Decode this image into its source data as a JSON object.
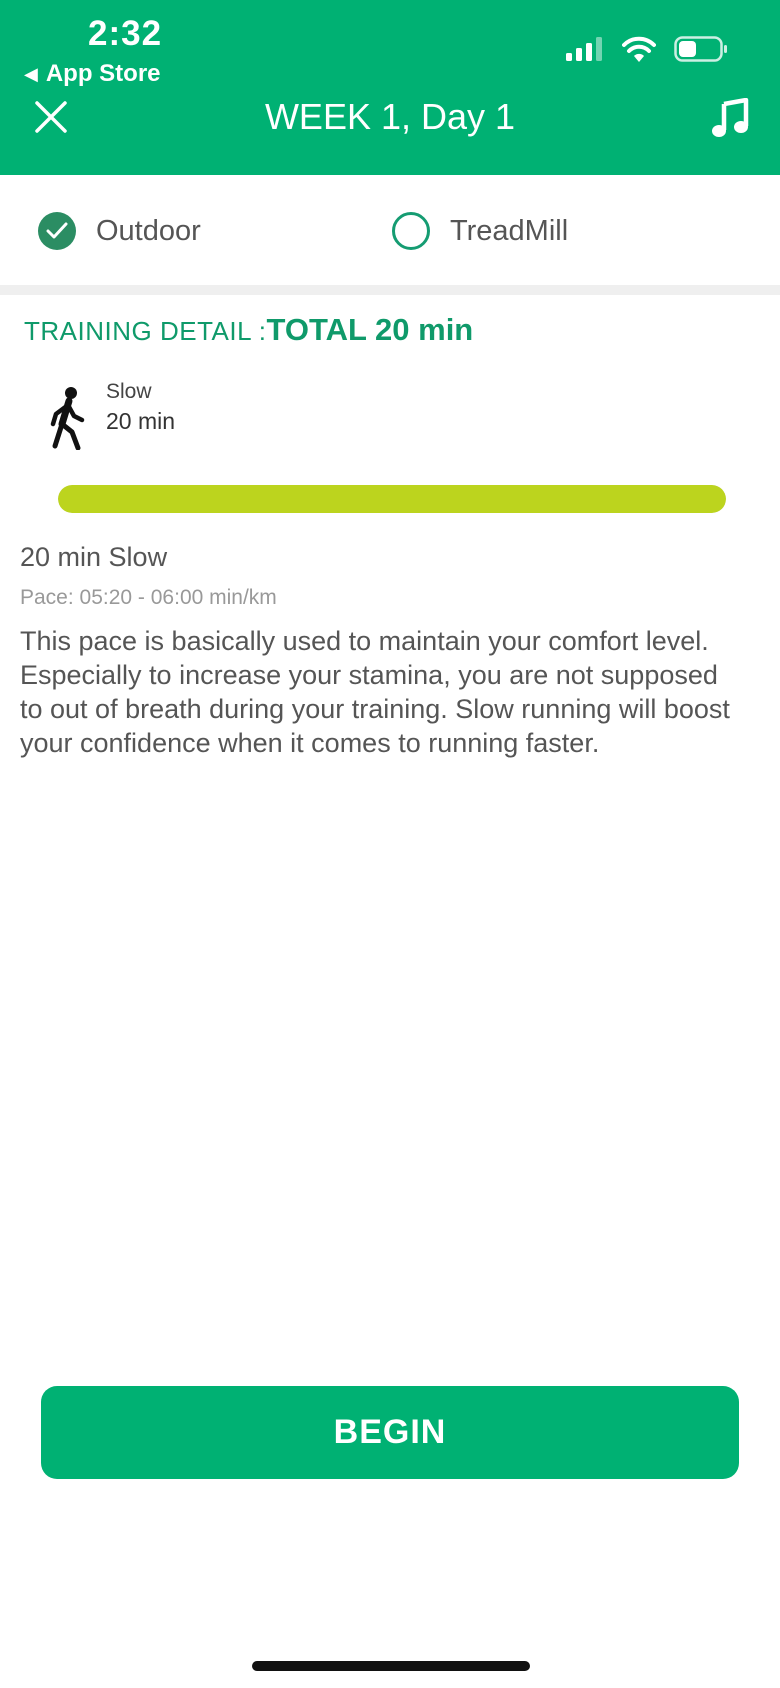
{
  "status_bar": {
    "time": "2:32",
    "back_label": "App Store",
    "back_arrow_icon": "triangle-left-icon",
    "icons": [
      "cellular-signal-icon",
      "wifi-icon",
      "battery-icon"
    ]
  },
  "nav": {
    "close_icon": "close-icon",
    "title": "WEEK 1, Day 1",
    "music_icon": "music-note-icon"
  },
  "modes": {
    "outdoor": {
      "label": "Outdoor",
      "selected": true
    },
    "treadmill": {
      "label": "TreadMill",
      "selected": false
    }
  },
  "training": {
    "label": "TRAINING DETAIL :",
    "total": "TOTAL 20 min",
    "segments": [
      {
        "type": "Slow",
        "duration": "20 min",
        "icon": "walking-person-icon"
      }
    ],
    "progress": 1.0,
    "progress_color": "#bcd41e"
  },
  "info": {
    "title": "20 min Slow",
    "pace": "Pace: 05:20 - 06:00 min/km",
    "description": "This pace is basically used to maintain your comfort level. Especially to increase your stamina, you are not supposed to out of breath during your training. Slow running will boost your confidence when it comes to running faster."
  },
  "actions": {
    "begin_label": "BEGIN"
  },
  "colors": {
    "primary": "#00b173",
    "accent_text": "#0f9a6a",
    "progress": "#bcd41e"
  }
}
